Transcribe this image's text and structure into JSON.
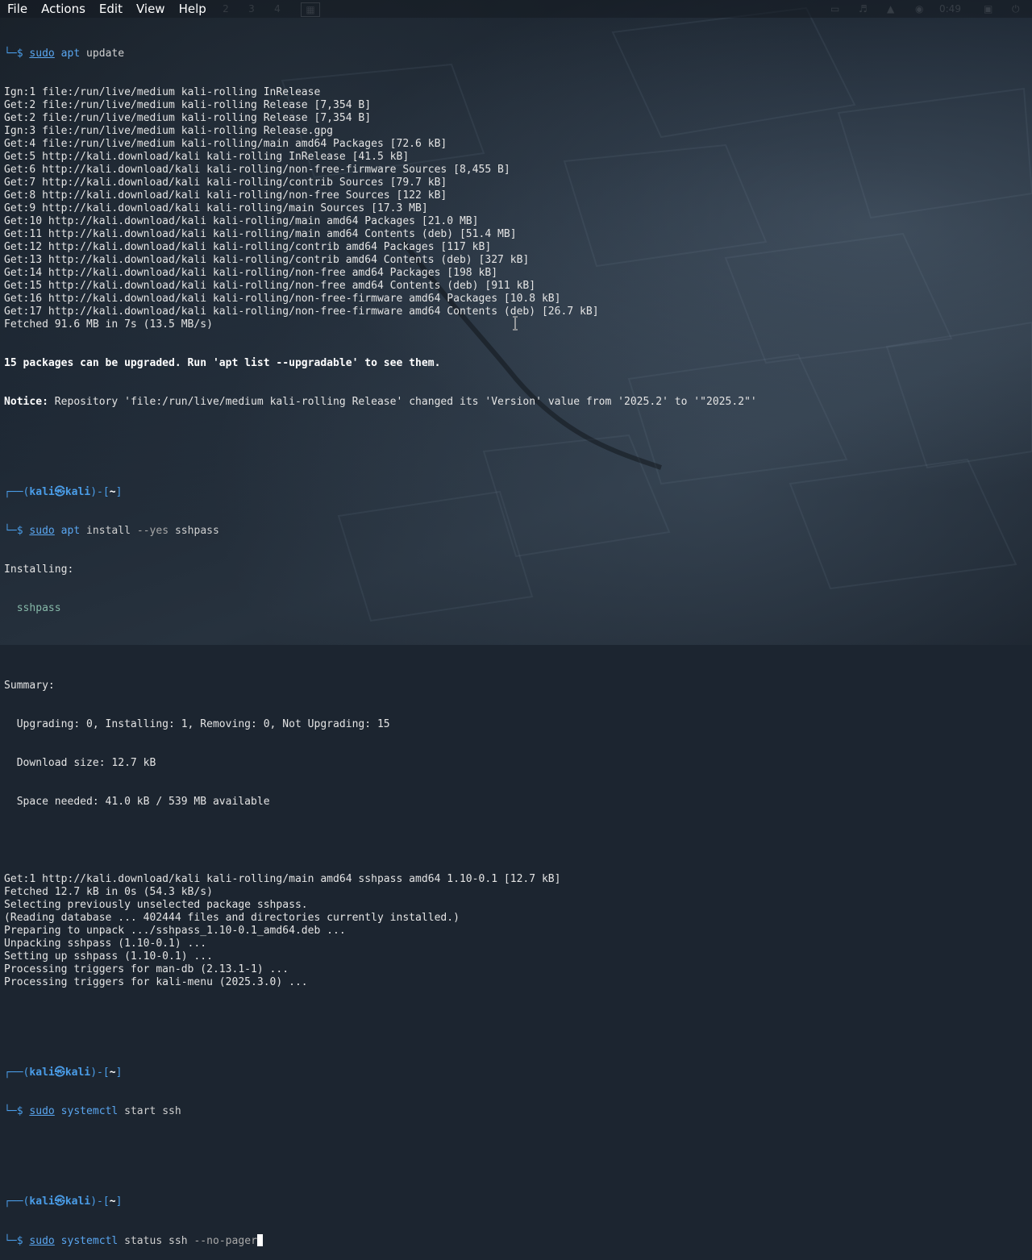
{
  "menubar": {
    "items": [
      "File",
      "Actions",
      "Edit",
      "View",
      "Help"
    ],
    "workspaces": [
      "1",
      "2",
      "3",
      "4"
    ],
    "clock": "0:49"
  },
  "prompt": {
    "user": "kali",
    "host": "kali",
    "dir": "~"
  },
  "terminal": {
    "update_cmd": "update",
    "update_output": [
      "Ign:1 file:/run/live/medium kali-rolling InRelease",
      "Get:2 file:/run/live/medium kali-rolling Release [7,354 B]",
      "Get:2 file:/run/live/medium kali-rolling Release [7,354 B]",
      "Ign:3 file:/run/live/medium kali-rolling Release.gpg",
      "Get:4 file:/run/live/medium kali-rolling/main amd64 Packages [72.6 kB]",
      "Get:5 http://kali.download/kali kali-rolling InRelease [41.5 kB]",
      "Get:6 http://kali.download/kali kali-rolling/non-free-firmware Sources [8,455 B]",
      "Get:7 http://kali.download/kali kali-rolling/contrib Sources [79.7 kB]",
      "Get:8 http://kali.download/kali kali-rolling/non-free Sources [122 kB]",
      "Get:9 http://kali.download/kali kali-rolling/main Sources [17.3 MB]",
      "Get:10 http://kali.download/kali kali-rolling/main amd64 Packages [21.0 MB]",
      "Get:11 http://kali.download/kali kali-rolling/main amd64 Contents (deb) [51.4 MB]",
      "Get:12 http://kali.download/kali kali-rolling/contrib amd64 Packages [117 kB]",
      "Get:13 http://kali.download/kali kali-rolling/contrib amd64 Contents (deb) [327 kB]",
      "Get:14 http://kali.download/kali kali-rolling/non-free amd64 Packages [198 kB]",
      "Get:15 http://kali.download/kali kali-rolling/non-free amd64 Contents (deb) [911 kB]",
      "Get:16 http://kali.download/kali kali-rolling/non-free-firmware amd64 Packages [10.8 kB]",
      "Get:17 http://kali.download/kali kali-rolling/non-free-firmware amd64 Contents (deb) [26.7 kB]",
      "Fetched 91.6 MB in 7s (13.5 MB/s)"
    ],
    "upgradable_msg": "15 packages can be upgraded. Run 'apt list --upgradable' to see them.",
    "notice_label": "Notice:",
    "notice_text": " Repository 'file:/run/live/medium kali-rolling Release' changed its 'Version' value from '2025.2' to '\"2025.2\"'",
    "install_cmd_sub": "install",
    "install_opt": "--yes",
    "install_pkg": "sshpass",
    "installing_label": "Installing:",
    "installing_pkg": "  sshpass",
    "summary_label": "Summary:",
    "summary_lines": [
      "  Upgrading: 0, Installing: 1, Removing: 0, Not Upgrading: 15",
      "  Download size: 12.7 kB",
      "  Space needed: 41.0 kB / 539 MB available"
    ],
    "install_output": [
      "Get:1 http://kali.download/kali kali-rolling/main amd64 sshpass amd64 1.10-0.1 [12.7 kB]",
      "Fetched 12.7 kB in 0s (54.3 kB/s)",
      "Selecting previously unselected package sshpass.",
      "(Reading database ... 402444 files and directories currently installed.)",
      "Preparing to unpack .../sshpass_1.10-0.1_amd64.deb ...",
      "Unpacking sshpass (1.10-0.1) ...",
      "Setting up sshpass (1.10-0.1) ...",
      "Processing triggers for man-db (2.13.1-1) ...",
      "Processing triggers for kali-menu (2025.3.0) ..."
    ],
    "start_cmd": " start ssh",
    "status_cmd": " status ssh",
    "status_opt": "--no-pager"
  }
}
